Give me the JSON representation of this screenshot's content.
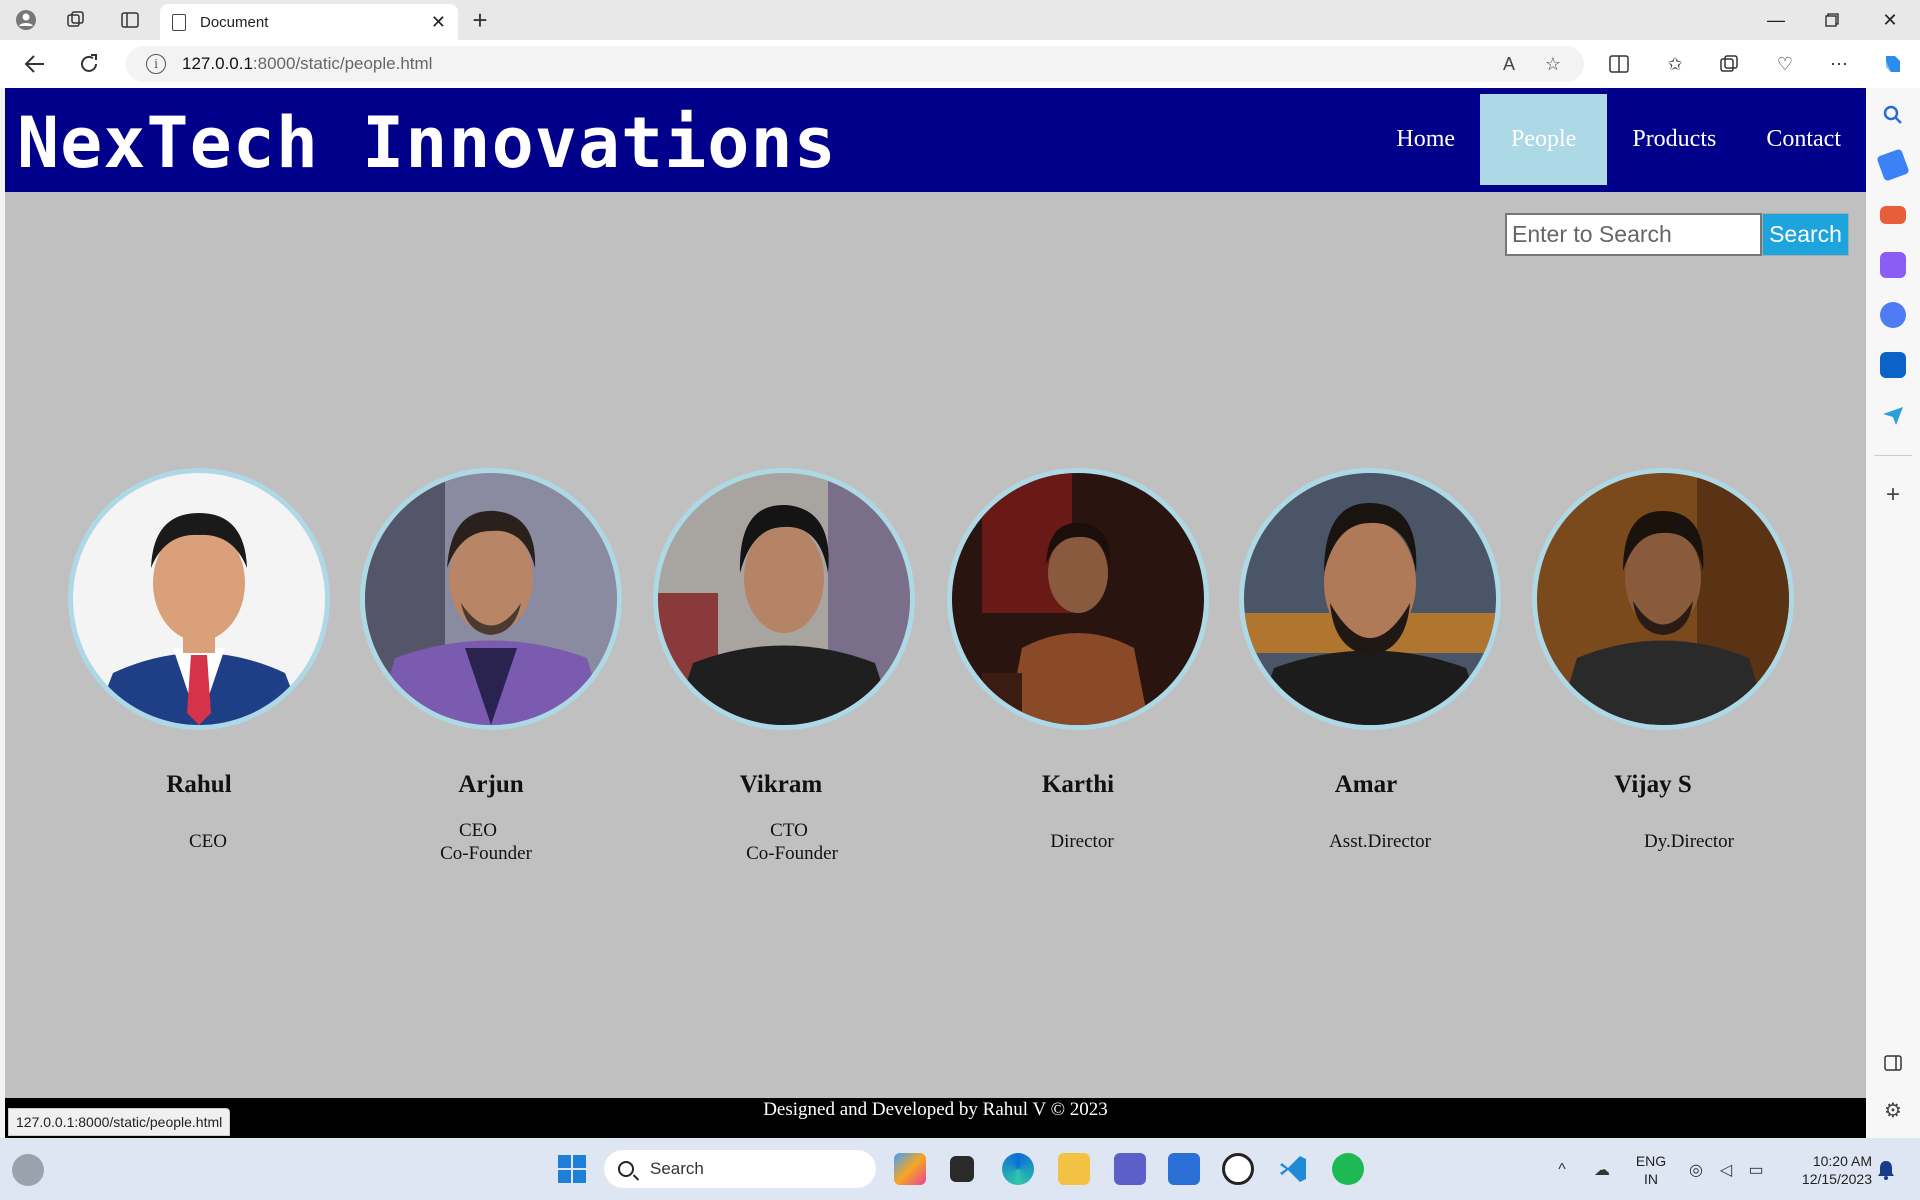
{
  "browser": {
    "tab_title": "Document",
    "url_host": "127.0.0.1",
    "url_rest": ":8000/static/people.html",
    "status_url": "127.0.0.1:8000/static/people.html"
  },
  "site": {
    "title": "NexTech Innovations",
    "nav": [
      "Home",
      "People",
      "Products",
      "Contact"
    ],
    "active_nav": "People",
    "search_placeholder": "Enter to Search",
    "search_button": "Search",
    "people": [
      {
        "name": "Rahul",
        "role1": "CEO",
        "role2": ""
      },
      {
        "name": "Arjun",
        "role1": "CEO",
        "role2": "Co-Founder"
      },
      {
        "name": "Vikram",
        "role1": "CTO",
        "role2": "Co-Founder"
      },
      {
        "name": "Karthi",
        "role1": "Director",
        "role2": ""
      },
      {
        "name": "Amar",
        "role1": "Asst.Director",
        "role2": ""
      },
      {
        "name": "Vijay S",
        "role1": "Dy.Director",
        "role2": ""
      }
    ],
    "footer": "Designed and Developed by Rahul V © 2023"
  },
  "taskbar": {
    "search_label": "Search",
    "lang_line1": "ENG",
    "lang_line2": "IN",
    "time": "10:20 AM",
    "date": "12/15/2023"
  },
  "colors": {
    "header_bg": "#00008b",
    "nav_active_bg": "#add8e6",
    "page_bg": "#c0c0c0",
    "search_button_bg": "#1ea4dc",
    "footer_bg": "#000000"
  }
}
